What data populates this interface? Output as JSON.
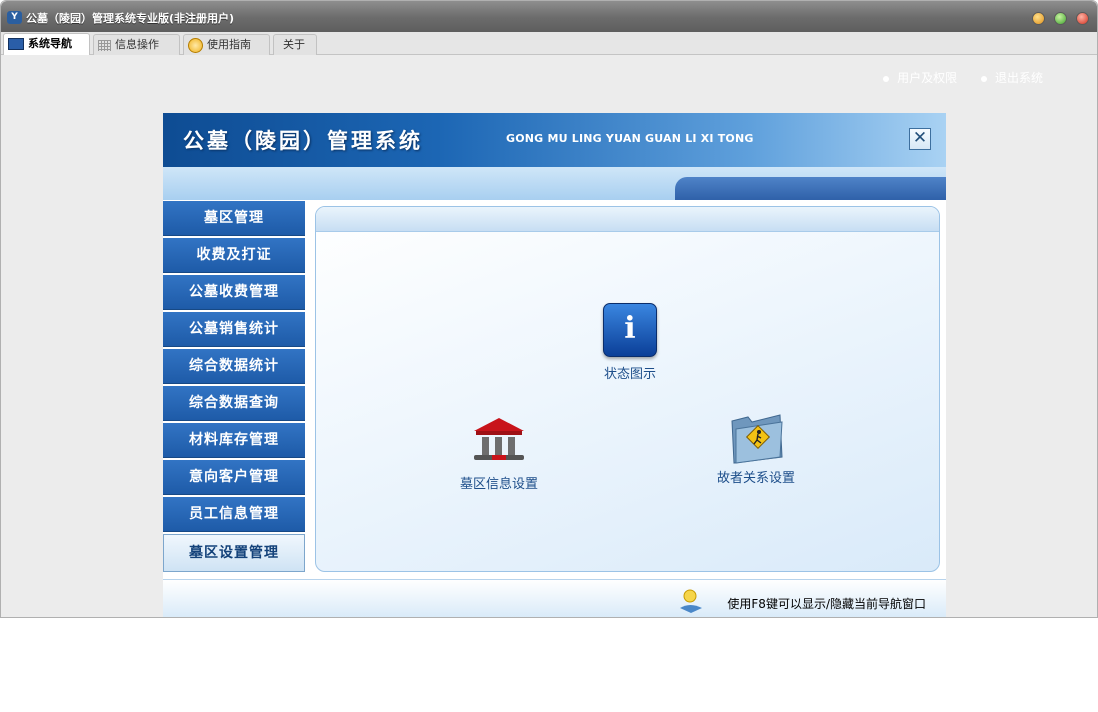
{
  "window": {
    "title": "公墓（陵园）管理系统专业版(非注册用户)"
  },
  "tabs": [
    {
      "label": "系统导航",
      "icon": "monitor-icon",
      "active": true
    },
    {
      "label": "信息操作",
      "icon": "grid-icon",
      "active": false
    },
    {
      "label": "使用指南",
      "icon": "help-icon",
      "active": false
    },
    {
      "label": "关于",
      "icon": "",
      "active": false
    }
  ],
  "banner": {
    "title": "公墓（陵园）管理系统",
    "pinyin": "GONG MU LING YUAN GUAN LI XI TONG",
    "close_symbol": "✕"
  },
  "top_links": [
    {
      "label": "用户及权限"
    },
    {
      "label": "退出系统"
    }
  ],
  "nav": {
    "items": [
      {
        "label": "墓区管理"
      },
      {
        "label": "收费及打证"
      },
      {
        "label": "公墓收费管理"
      },
      {
        "label": "公墓销售统计"
      },
      {
        "label": "综合数据统计"
      },
      {
        "label": "综合数据查询"
      },
      {
        "label": "材料库存管理"
      },
      {
        "label": "意向客户管理"
      },
      {
        "label": "员工信息管理"
      },
      {
        "label": "墓区设置管理"
      }
    ],
    "selected": "墓区设置管理"
  },
  "launchers": [
    {
      "label": "状态图示",
      "icon": "info-icon",
      "glyph": "i"
    },
    {
      "label": "墓区信息设置",
      "icon": "temple-icon"
    },
    {
      "label": "故者关系设置",
      "icon": "folder-icon"
    }
  ],
  "footer": {
    "hint": "使用F8键可以显示/隐藏当前导航窗口",
    "icon": "tip-icon"
  },
  "colors": {
    "banner_dark": "#0e4c93",
    "nav_blue": "#1e5ba8",
    "link_text": "#1d4e8a"
  }
}
